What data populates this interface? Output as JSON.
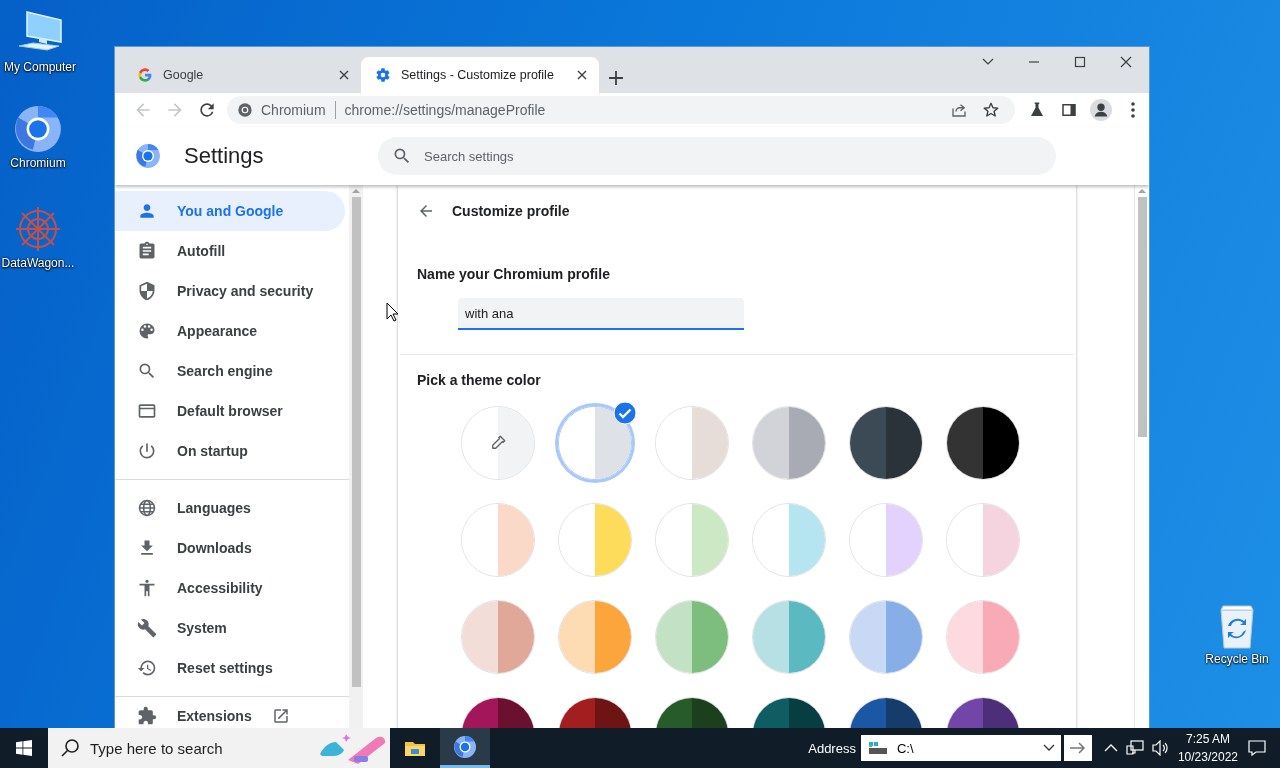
{
  "desktop": {
    "icons": [
      {
        "kind": "computer",
        "label": "My Computer"
      },
      {
        "kind": "chromium",
        "label": "Chromium"
      },
      {
        "kind": "app",
        "label": "DataWagon..."
      },
      {
        "kind": "recycle",
        "label": "Recycle Bin"
      }
    ]
  },
  "browser": {
    "tabs": [
      {
        "kind": "google",
        "title": "Google",
        "selected": false
      },
      {
        "kind": "settings",
        "title": "Settings - Customize profile",
        "selected": true
      }
    ],
    "nav_buttons": [
      {
        "kind": "back",
        "disabled": true
      },
      {
        "kind": "forward",
        "disabled": true
      },
      {
        "kind": "reload",
        "disabled": false
      }
    ],
    "omnibox": {
      "site": "Chromium",
      "url": "chrome://settings/manageProfile"
    }
  },
  "settings": {
    "title": "Settings",
    "search": {
      "placeholder": "Search settings"
    },
    "sidebar": {
      "sections": [
        {
          "items": [
            {
              "label": "You and Google",
              "selected": true
            },
            {
              "label": "Autofill",
              "selected": false
            },
            {
              "label": "Privacy and security",
              "selected": false
            },
            {
              "label": "Appearance",
              "selected": false
            },
            {
              "label": "Search engine",
              "selected": false
            },
            {
              "label": "Default browser",
              "selected": false
            },
            {
              "label": "On startup",
              "selected": false
            }
          ]
        },
        {
          "items": [
            {
              "label": "Languages",
              "selected": false
            },
            {
              "label": "Downloads",
              "selected": false
            },
            {
              "label": "Accessibility",
              "selected": false
            },
            {
              "label": "System",
              "selected": false
            },
            {
              "label": "Reset settings",
              "selected": false
            }
          ]
        },
        {
          "items": [
            {
              "label": "Extensions",
              "selected": false,
              "external": true
            }
          ]
        }
      ]
    },
    "page": {
      "title": "Customize profile",
      "name_label": "Name your Chromium profile",
      "name_value": "with ana",
      "theme_label": "Pick a theme color",
      "swatches": [
        {
          "kind": "picker",
          "halves": [
            {
              "color": "#ffffff"
            },
            {
              "color": "#f1f3f4"
            }
          ],
          "selected": false
        },
        {
          "kind": "color",
          "halves": [
            {
              "color": "#ffffff"
            },
            {
              "color": "#dee1e6"
            }
          ],
          "selected": true
        },
        {
          "kind": "color",
          "halves": [
            {
              "color": "#ffffff"
            },
            {
              "color": "#e6dcd8"
            }
          ],
          "selected": false
        },
        {
          "kind": "color",
          "halves": [
            {
              "color": "#d1d3d8"
            },
            {
              "color": "#a8abb3"
            }
          ],
          "selected": false
        },
        {
          "kind": "color",
          "halves": [
            {
              "color": "#3c4a55"
            },
            {
              "color": "#2a3339"
            }
          ],
          "selected": false
        },
        {
          "kind": "color",
          "halves": [
            {
              "color": "#333333"
            },
            {
              "color": "#000000"
            }
          ],
          "selected": false
        },
        {
          "kind": "color",
          "halves": [
            {
              "color": "#ffffff"
            },
            {
              "color": "#fbd9c9"
            }
          ],
          "selected": false
        },
        {
          "kind": "color",
          "halves": [
            {
              "color": "#ffffff"
            },
            {
              "color": "#fddc5b"
            }
          ],
          "selected": false
        },
        {
          "kind": "color",
          "halves": [
            {
              "color": "#ffffff"
            },
            {
              "color": "#cde8c4"
            }
          ],
          "selected": false
        },
        {
          "kind": "color",
          "halves": [
            {
              "color": "#ffffff"
            },
            {
              "color": "#b4e5f1"
            }
          ],
          "selected": false
        },
        {
          "kind": "color",
          "halves": [
            {
              "color": "#ffffff"
            },
            {
              "color": "#e3d2fd"
            }
          ],
          "selected": false
        },
        {
          "kind": "color",
          "halves": [
            {
              "color": "#ffffff"
            },
            {
              "color": "#f5d4e0"
            }
          ],
          "selected": false
        },
        {
          "kind": "color",
          "halves": [
            {
              "color": "#f3ddd8"
            },
            {
              "color": "#e0a898"
            }
          ],
          "selected": false
        },
        {
          "kind": "color",
          "halves": [
            {
              "color": "#fddbb3"
            },
            {
              "color": "#fba53c"
            }
          ],
          "selected": false
        },
        {
          "kind": "color",
          "halves": [
            {
              "color": "#c3e2c5"
            },
            {
              "color": "#7dbd7e"
            }
          ],
          "selected": false
        },
        {
          "kind": "color",
          "halves": [
            {
              "color": "#b6e0e4"
            },
            {
              "color": "#5bb9c2"
            }
          ],
          "selected": false
        },
        {
          "kind": "color",
          "halves": [
            {
              "color": "#c8d9f6"
            },
            {
              "color": "#87aee7"
            }
          ],
          "selected": false
        },
        {
          "kind": "color",
          "halves": [
            {
              "color": "#fdd9e0"
            },
            {
              "color": "#f9aab7"
            }
          ],
          "selected": false
        },
        {
          "kind": "color",
          "halves": [
            {
              "color": "#a3175a"
            },
            {
              "color": "#6c1030"
            }
          ],
          "selected": false
        },
        {
          "kind": "color",
          "halves": [
            {
              "color": "#a31e1e"
            },
            {
              "color": "#6e1414"
            }
          ],
          "selected": false
        },
        {
          "kind": "color",
          "halves": [
            {
              "color": "#275c2a"
            },
            {
              "color": "#1c3f1d"
            }
          ],
          "selected": false
        },
        {
          "kind": "color",
          "halves": [
            {
              "color": "#0d5d62"
            },
            {
              "color": "#073e42"
            }
          ],
          "selected": false
        },
        {
          "kind": "color",
          "halves": [
            {
              "color": "#1b57a5"
            },
            {
              "color": "#163c6c"
            }
          ],
          "selected": false
        },
        {
          "kind": "color",
          "halves": [
            {
              "color": "#7246a9"
            },
            {
              "color": "#4d2e78"
            }
          ],
          "selected": false
        }
      ]
    }
  },
  "taskbar": {
    "search": {
      "placeholder": "Type here to search"
    },
    "apps": [
      {
        "kind": "explorer",
        "active": false
      },
      {
        "kind": "chromium",
        "active": true
      }
    ],
    "address": {
      "label": "Address",
      "value": "C:\\"
    },
    "clock": {
      "time": "7:25 AM",
      "date": "10/23/2022"
    }
  }
}
